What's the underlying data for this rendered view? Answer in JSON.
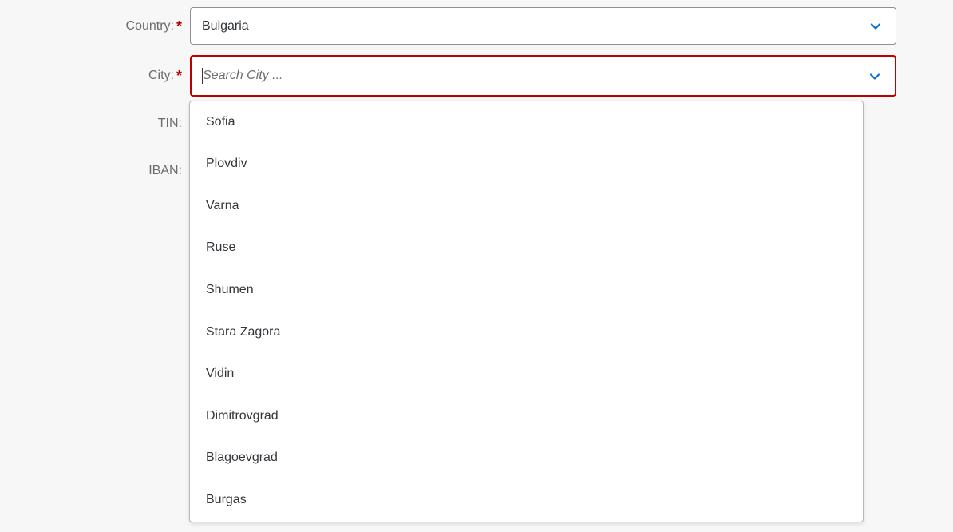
{
  "form": {
    "country": {
      "label": "Country:",
      "required_mark": "*",
      "value": "Bulgaria"
    },
    "city": {
      "label": "City:",
      "required_mark": "*",
      "placeholder": "Search City ..."
    },
    "tin": {
      "label": "TIN:"
    },
    "iban": {
      "label": "IBAN:"
    }
  },
  "city_options": [
    "Sofia",
    "Plovdiv",
    "Varna",
    "Ruse",
    "Shumen",
    "Stara Zagora",
    "Vidin",
    "Dimitrovgrad",
    "Blagoevgrad",
    "Burgas"
  ],
  "colors": {
    "accent": "#0a6ed1",
    "error_border": "#bb0000",
    "required": "#bb0000",
    "label": "#6a6d70",
    "background": "#f7f7f7"
  },
  "icons": {
    "dropdown_arrow": "chevron-down-icon"
  }
}
